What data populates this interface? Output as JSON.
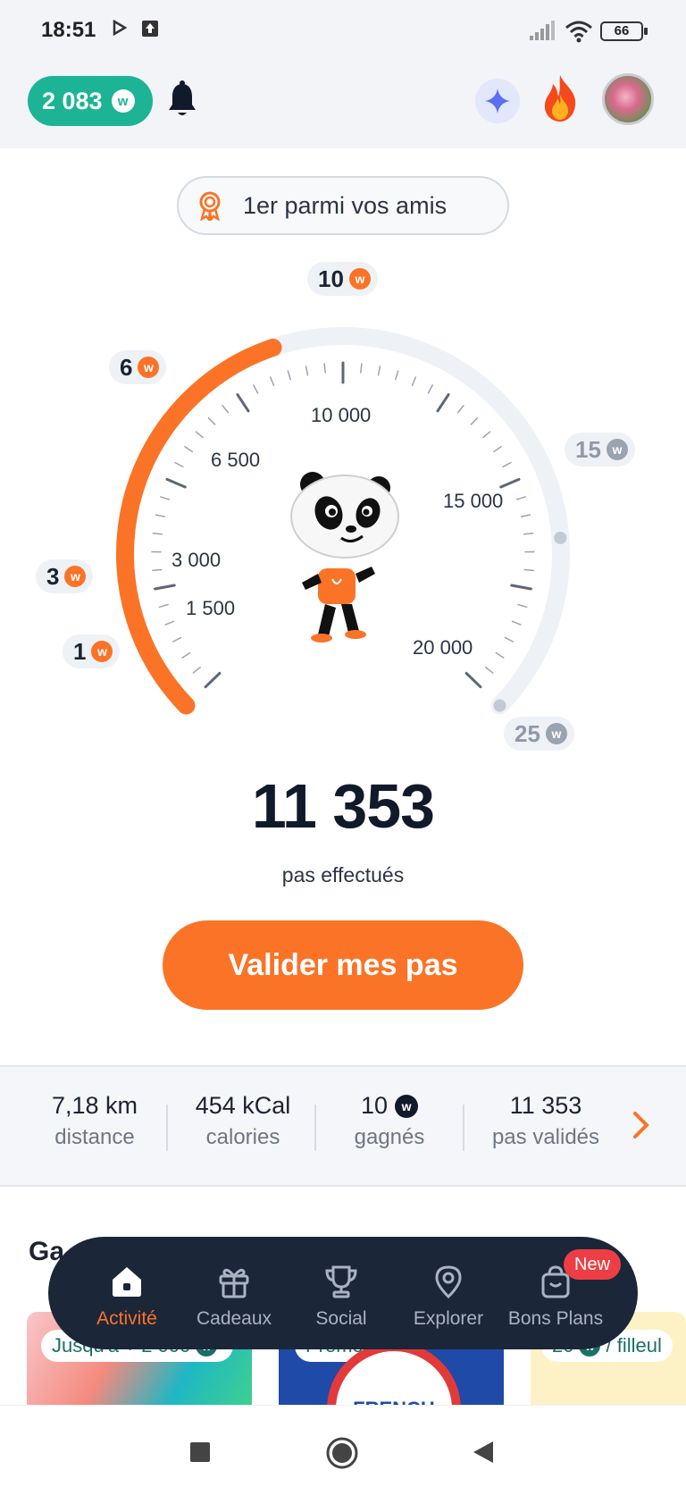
{
  "status_bar": {
    "time": "18:51",
    "battery": "66"
  },
  "header": {
    "coin_balance": "2 083",
    "coin_symbol": "w"
  },
  "rank": {
    "label": "1er parmi vos amis"
  },
  "gauge": {
    "rewards": [
      {
        "value": "1",
        "symbol": "w",
        "state": "earned"
      },
      {
        "value": "3",
        "symbol": "w",
        "state": "earned"
      },
      {
        "value": "6",
        "symbol": "w",
        "state": "earned"
      },
      {
        "value": "10",
        "symbol": "w",
        "state": "earned"
      },
      {
        "value": "15",
        "symbol": "w",
        "state": "future"
      },
      {
        "value": "25",
        "symbol": "w",
        "state": "future"
      }
    ],
    "tick_labels": [
      "1 500",
      "3 000",
      "6 500",
      "10 000",
      "15 000",
      "20 000"
    ],
    "progress_fraction": 0.43,
    "progress_color": "#fa7327",
    "track_color": "#eef1f6"
  },
  "steps": {
    "count": "11 353",
    "caption": "pas effectués"
  },
  "validate_button": {
    "label": "Valider mes pas"
  },
  "stats": [
    {
      "value": "7,18 km",
      "label": "distance"
    },
    {
      "value": "454 kCal",
      "label": "calories"
    },
    {
      "value": "10",
      "label": "gagnés",
      "coin": "w"
    },
    {
      "value": "11 353",
      "label": "pas validés"
    }
  ],
  "section": {
    "title": "Ga"
  },
  "cards": [
    {
      "chip": "Jusqu'à + 2 000",
      "coin": "w"
    },
    {
      "chip": "Promos",
      "badge_text": "FRENCH"
    },
    {
      "chip_value": "20",
      "coin": "w",
      "chip_suffix": "/ filleul"
    }
  ],
  "nav": {
    "items": [
      {
        "label": "Activité",
        "icon": "home-icon"
      },
      {
        "label": "Cadeaux",
        "icon": "gift-icon"
      },
      {
        "label": "Social",
        "icon": "trophy-icon"
      },
      {
        "label": "Explorer",
        "icon": "map-pin-icon"
      },
      {
        "label": "Bons Plans",
        "icon": "shopping-bag-icon"
      }
    ],
    "new_badge": "New"
  },
  "colors": {
    "accent": "#fa7327",
    "brand_green": "#1cb495",
    "nav_bg": "#1c2639"
  }
}
